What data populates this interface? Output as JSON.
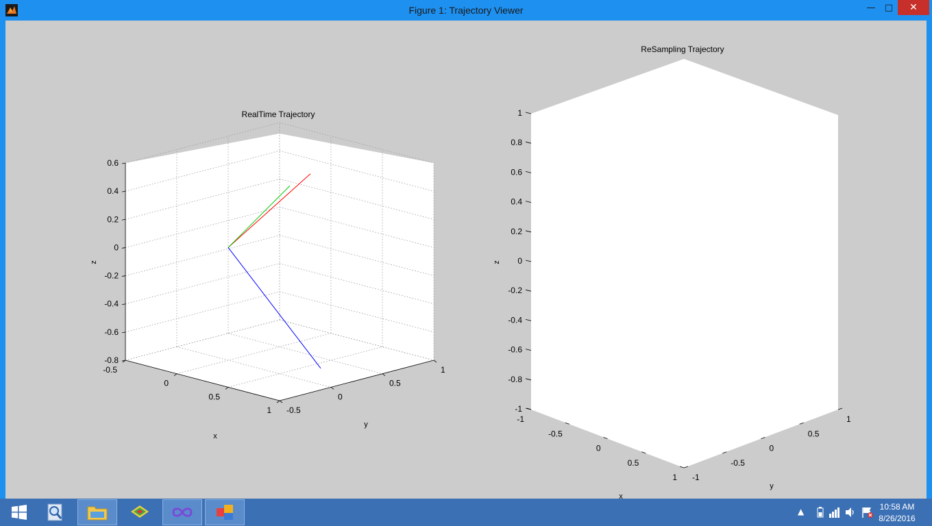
{
  "window": {
    "title": "Figure 1: Trajectory Viewer",
    "min_glyph": "—",
    "max_glyph": "□",
    "close_glyph": "✕"
  },
  "colors": {
    "titlebar": "#1e90f0",
    "figure_bg": "#cccccc",
    "axes_bg": "#ffffff",
    "taskbar": "#3c70b4",
    "close": "#c7302a"
  },
  "chart_data": [
    {
      "type": "line",
      "title": "RealTime Trajectory",
      "xlabel": "x",
      "ylabel": "y",
      "zlabel": "z",
      "grid": true,
      "x_ticks": [
        "-0.5",
        "0",
        "0.5",
        "1"
      ],
      "y_ticks": [
        "-0.5",
        "0",
        "0.5",
        "1"
      ],
      "z_ticks": [
        "0.6",
        "0.4",
        "0.2",
        "0",
        "-0.2",
        "-0.4",
        "-0.6",
        "-0.8"
      ],
      "series": [
        {
          "color": "#ff0000",
          "start": [
            0,
            0,
            0
          ],
          "end": [
            0.6,
            0.2,
            0.6
          ]
        },
        {
          "color": "#00cc00",
          "start": [
            0,
            0,
            0
          ],
          "end": [
            0.2,
            0.4,
            0.4
          ]
        },
        {
          "color": "#0000ff",
          "start": [
            0,
            0,
            0
          ],
          "end": [
            0.6,
            0.3,
            -0.8
          ]
        }
      ]
    },
    {
      "type": "line",
      "title": "ReSampling Trajectory",
      "xlabel": "x",
      "ylabel": "y",
      "zlabel": "z",
      "grid": false,
      "x_ticks": [
        "-1",
        "-0.5",
        "0",
        "0.5",
        "1"
      ],
      "y_ticks": [
        "-1",
        "-0.5",
        "0",
        "0.5",
        "1"
      ],
      "z_ticks": [
        "1",
        "0.8",
        "0.6",
        "0.4",
        "0.2",
        "0",
        "-0.2",
        "-0.4",
        "-0.6",
        "-0.8",
        "-1"
      ],
      "series": []
    }
  ],
  "taskbar": {
    "items": [
      {
        "name": "start-button",
        "icon": "windows-logo-icon"
      },
      {
        "name": "search-app-button",
        "icon": "magnifier-icon"
      },
      {
        "name": "file-explorer-button",
        "icon": "folder-icon"
      },
      {
        "name": "app-stack-button",
        "icon": "layers-icon"
      },
      {
        "name": "infinity-app-button",
        "icon": "infinity-icon"
      },
      {
        "name": "figure-app-button",
        "icon": "squares-icon"
      }
    ],
    "time": "10:58 AM",
    "date": "8/26/2016",
    "tray_arrow": "▲"
  }
}
